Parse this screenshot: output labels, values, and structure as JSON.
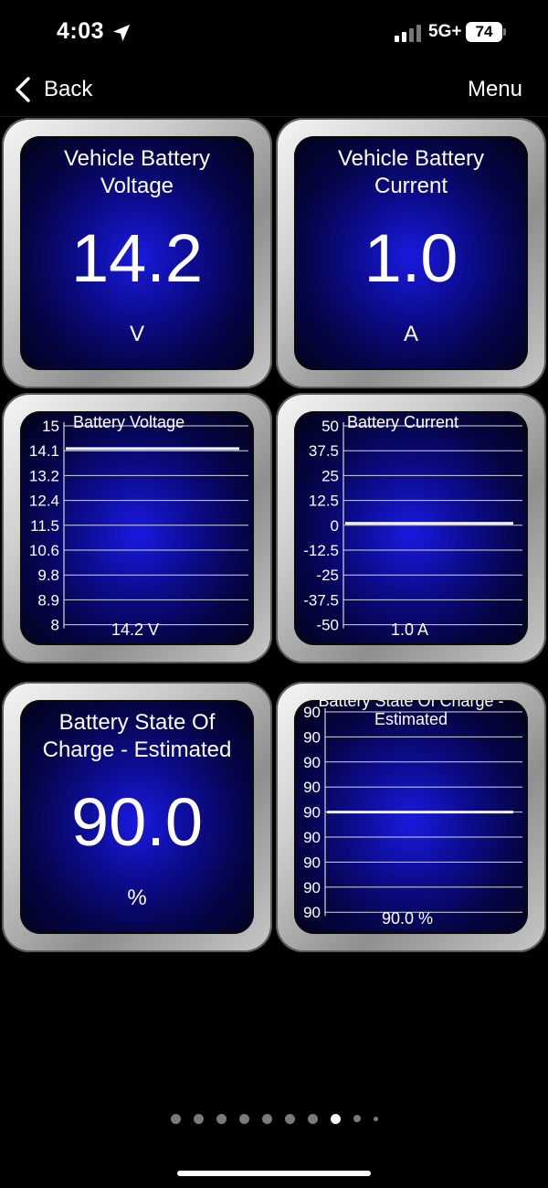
{
  "status_bar": {
    "time": "4:03",
    "network": "5G+",
    "battery": "74",
    "icons": [
      "location-arrow-icon",
      "signal-icon",
      "battery-icon"
    ]
  },
  "nav": {
    "back_label": "Back",
    "menu_label": "Menu"
  },
  "gauges": {
    "voltage": {
      "title": "Vehicle Battery Voltage",
      "value": "14.2",
      "unit": "V"
    },
    "current": {
      "title": "Vehicle Battery Current",
      "value": "1.0",
      "unit": "A"
    },
    "soc": {
      "title": "Battery State Of Charge - Estimated",
      "value": "90.0",
      "unit": "%"
    }
  },
  "chart_data": [
    {
      "type": "line",
      "title": "Battery Voltage",
      "y_ticks": [
        "15",
        "14.1",
        "13.2",
        "12.4",
        "11.5",
        "10.6",
        "9.8",
        "8.9",
        "8"
      ],
      "ylim": [
        8,
        15
      ],
      "series": [
        {
          "values": [
            14.2,
            14.2
          ]
        }
      ],
      "readout": "14.2 V",
      "grid": true
    },
    {
      "type": "line",
      "title": "Battery Current",
      "y_ticks": [
        "50",
        "37.5",
        "25",
        "12.5",
        "0",
        "-12.5",
        "-25",
        "-37.5",
        "-50"
      ],
      "ylim": [
        -50,
        50
      ],
      "series": [
        {
          "values": [
            1.0,
            1.0
          ]
        }
      ],
      "readout": "1.0 A",
      "grid": true
    },
    {
      "type": "line",
      "title": "Battery State Of Charge - Estimated",
      "y_ticks": [
        "90",
        "90",
        "90",
        "90",
        "90",
        "90",
        "90",
        "90",
        "90"
      ],
      "ylim": [
        90,
        90
      ],
      "series": [
        {
          "values": [
            90.0,
            90.0
          ]
        }
      ],
      "readout": "90.0 %",
      "grid": true
    }
  ],
  "pager": {
    "count": 10,
    "active_index": 7
  },
  "colors": {
    "tile_face": "#0c0c8f",
    "tile_glow": "#1a1ae0",
    "bezel": "#cfcfcf",
    "background": "#000000"
  }
}
